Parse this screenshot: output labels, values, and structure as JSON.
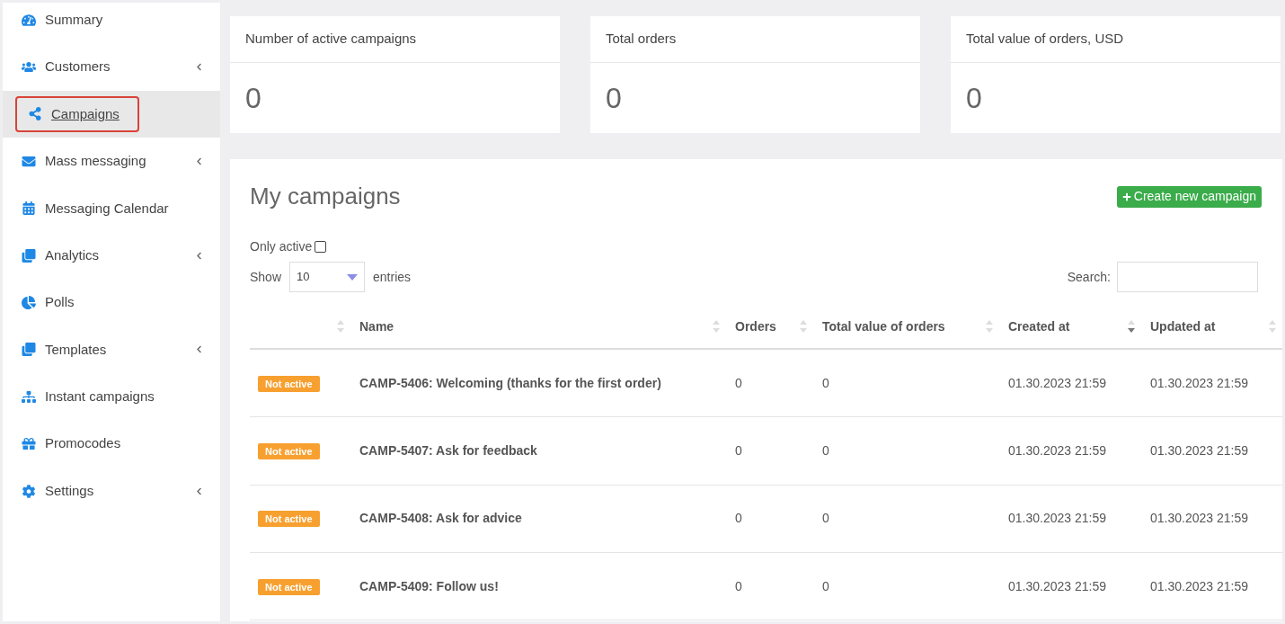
{
  "sidebar": {
    "items": [
      {
        "label": "Summary",
        "selected": false,
        "expandable": false
      },
      {
        "label": "Customers",
        "selected": false,
        "expandable": true
      },
      {
        "label": "Campaigns",
        "selected": true,
        "expandable": false
      },
      {
        "label": "Mass messaging",
        "selected": false,
        "expandable": true
      },
      {
        "label": "Messaging Calendar",
        "selected": false,
        "expandable": false
      },
      {
        "label": "Analytics",
        "selected": false,
        "expandable": true
      },
      {
        "label": "Polls",
        "selected": false,
        "expandable": false
      },
      {
        "label": "Templates",
        "selected": false,
        "expandable": true
      },
      {
        "label": "Instant campaigns",
        "selected": false,
        "expandable": false
      },
      {
        "label": "Promocodes",
        "selected": false,
        "expandable": false
      },
      {
        "label": "Settings",
        "selected": false,
        "expandable": true
      }
    ]
  },
  "stats": [
    {
      "title": "Number of active campaigns",
      "value": "0"
    },
    {
      "title": "Total orders",
      "value": "0"
    },
    {
      "title": "Total value of orders, USD",
      "value": "0"
    }
  ],
  "campaigns": {
    "title": "My campaigns",
    "create_button": "Create new campaign",
    "only_active": {
      "label": "Only active",
      "checked": false
    },
    "show": {
      "label": "Show",
      "value": "10",
      "suffix": "entries"
    },
    "search": {
      "label": "Search:"
    },
    "table": {
      "columns": [
        {
          "sorted": false
        },
        {
          "label": "Name",
          "sorted": false
        },
        {
          "label": "Orders",
          "sorted": false
        },
        {
          "label": "Total value of orders",
          "sorted": false
        },
        {
          "label": "Created at",
          "sorted": true
        },
        {
          "label": "Updated at",
          "sorted": false
        }
      ],
      "rows": [
        {
          "status": "Not active",
          "active": false,
          "name": "CAMP-5406: Welcoming (thanks for the first order)",
          "orders": "0",
          "total": "0",
          "created": "01.30.2023 21:59",
          "updated": "01.30.2023 21:59"
        },
        {
          "status": "Not active",
          "active": false,
          "name": "CAMP-5407: Ask for feedback",
          "orders": "0",
          "total": "0",
          "created": "01.30.2023 21:59",
          "updated": "01.30.2023 21:59"
        },
        {
          "status": "Not active",
          "active": false,
          "name": "CAMP-5408: Ask for advice",
          "orders": "0",
          "total": "0",
          "created": "01.30.2023 21:59",
          "updated": "01.30.2023 21:59"
        },
        {
          "status": "Not active",
          "active": false,
          "name": "CAMP-5409: Follow us!",
          "orders": "0",
          "total": "0",
          "created": "01.30.2023 21:59",
          "updated": "01.30.2023 21:59"
        }
      ]
    }
  }
}
